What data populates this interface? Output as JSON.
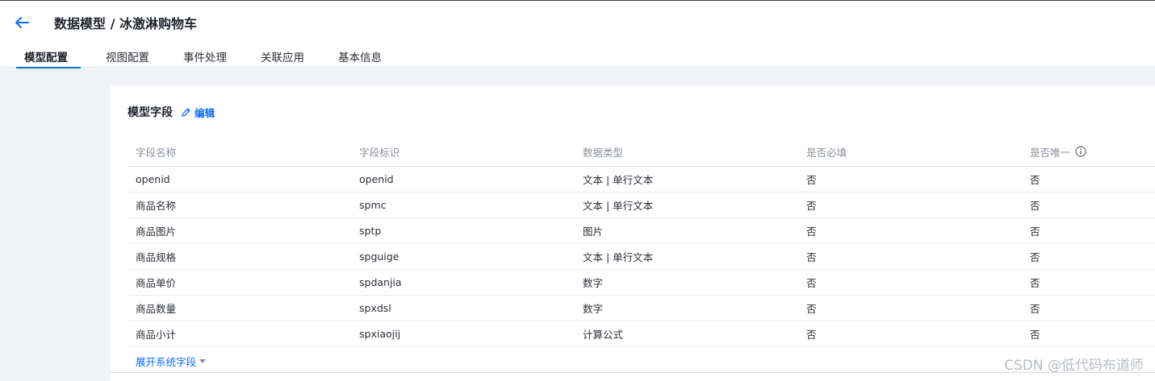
{
  "header": {
    "title": "数据模型 / 冰激淋购物车",
    "back_icon": "arrow-left-icon"
  },
  "tabs": [
    {
      "label": "模型配置",
      "active": true
    },
    {
      "label": "视图配置",
      "active": false
    },
    {
      "label": "事件处理",
      "active": false
    },
    {
      "label": "关联应用",
      "active": false
    },
    {
      "label": "基本信息",
      "active": false
    }
  ],
  "card": {
    "title": "模型字段",
    "edit_label": "编辑"
  },
  "table": {
    "columns": [
      "字段名称",
      "字段标识",
      "数据类型",
      "是否必填",
      "是否唯一"
    ],
    "rows": [
      [
        "openid",
        "openid",
        "文本 | 单行文本",
        "否",
        "否"
      ],
      [
        "商品名称",
        "spmc",
        "文本 | 单行文本",
        "否",
        "否"
      ],
      [
        "商品图片",
        "sptp",
        "图片",
        "否",
        "否"
      ],
      [
        "商品规格",
        "spguige",
        "文本 | 单行文本",
        "否",
        "否"
      ],
      [
        "商品单价",
        "spdanjia",
        "数字",
        "否",
        "否"
      ],
      [
        "商品数量",
        "spxdsl",
        "数字",
        "否",
        "否"
      ],
      [
        "商品小计",
        "spxiaojij",
        "计算公式",
        "否",
        "否"
      ]
    ]
  },
  "expand_label": "展开系统字段",
  "watermark": "CSDN @低代码布道师",
  "colors": {
    "accent": "#0a6cff",
    "page_bg": "#f1f3f6",
    "muted_text": "#8a9099"
  }
}
